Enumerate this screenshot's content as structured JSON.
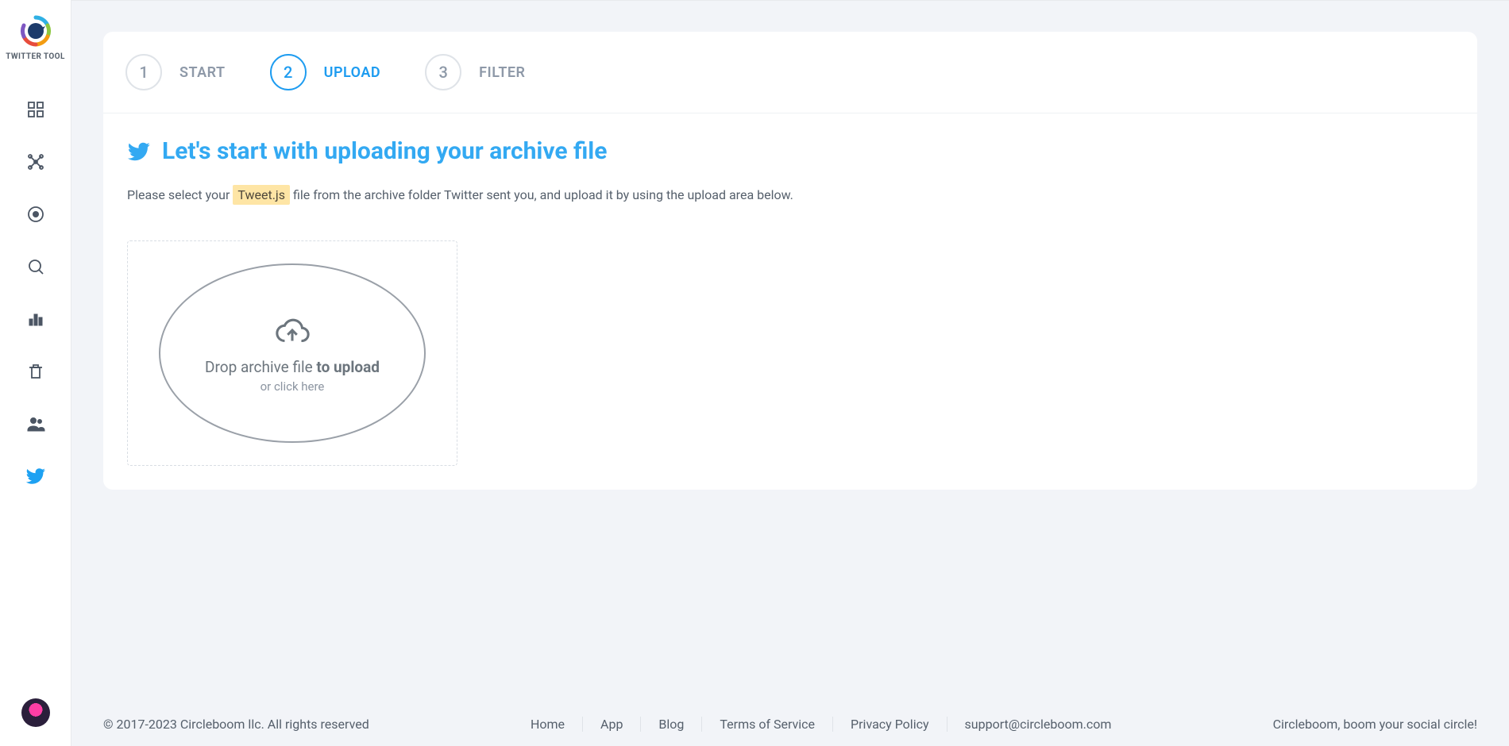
{
  "brand": {
    "name": "TWITTER TOOL"
  },
  "steps": [
    {
      "num": "1",
      "label": "START"
    },
    {
      "num": "2",
      "label": "UPLOAD"
    },
    {
      "num": "3",
      "label": "FILTER"
    }
  ],
  "page": {
    "title": "Let's start with uploading your archive file",
    "desc_before": "Please select your ",
    "desc_highlight": "Tweet.js",
    "desc_after": " file from the archive folder Twitter sent you, and upload it by using the upload area below."
  },
  "dropzone": {
    "line1_a": "Drop archive file ",
    "line1_b": "to upload",
    "line2": "or click here"
  },
  "footer": {
    "copyright": "© 2017-2023 Circleboom llc. All rights reserved",
    "links": [
      "Home",
      "App",
      "Blog",
      "Terms of Service",
      "Privacy Policy",
      "support@circleboom.com"
    ],
    "tagline": "Circleboom, boom your social circle!"
  },
  "icons": {
    "dashboard": "dashboard-icon",
    "network": "network-icon",
    "target": "target-icon",
    "search": "search-icon",
    "chart": "chart-icon",
    "trash": "trash-icon",
    "people": "people-icon",
    "twitter": "twitter-icon"
  }
}
